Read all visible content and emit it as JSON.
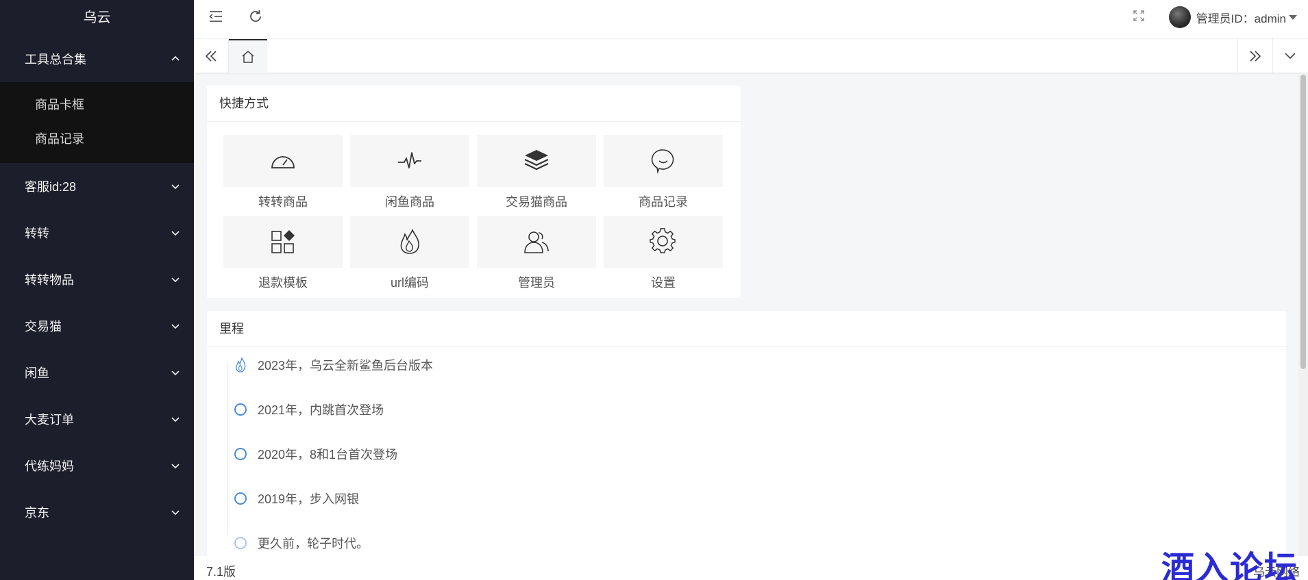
{
  "sidebar": {
    "logo": "乌云",
    "groups": [
      {
        "label": "工具总合集",
        "expanded": true,
        "items": [
          "商品卡框",
          "商品记录"
        ]
      },
      {
        "label": "客服id:28",
        "expanded": false
      },
      {
        "label": "转转",
        "expanded": false
      },
      {
        "label": "转转物品",
        "expanded": false
      },
      {
        "label": "交易猫",
        "expanded": false
      },
      {
        "label": "闲鱼",
        "expanded": false
      },
      {
        "label": "大麦订单",
        "expanded": false
      },
      {
        "label": "代练妈妈",
        "expanded": false
      },
      {
        "label": "京东",
        "expanded": false
      }
    ]
  },
  "header": {
    "user_label": "管理员ID：admin"
  },
  "shortcuts": {
    "title": "快捷方式",
    "items": [
      {
        "label": "转转商品",
        "icon": "dashboard-icon"
      },
      {
        "label": "闲鱼商品",
        "icon": "pulse-icon"
      },
      {
        "label": "交易猫商品",
        "icon": "layers-icon"
      },
      {
        "label": "商品记录",
        "icon": "chat-bubble-icon"
      },
      {
        "label": "退款模板",
        "icon": "apps-icon"
      },
      {
        "label": "url编码",
        "icon": "fire-icon"
      },
      {
        "label": "管理员",
        "icon": "users-icon"
      },
      {
        "label": "设置",
        "icon": "gear-icon"
      }
    ]
  },
  "milestones": {
    "title": "里程",
    "items": [
      "2023年，乌云全新鲨鱼后台版本",
      "2021年，内跳首次登场",
      "2020年，8和1台首次登场",
      "2019年，步入网银",
      "更久前，轮子时代。"
    ]
  },
  "footer": {
    "version": "7.1版",
    "right_text": "乌云网络"
  },
  "watermark": "酒入论坛",
  "colors": {
    "sidebar_bg": "#1d1e2c",
    "submenu_bg": "#121212",
    "timeline_accent": "#4a8ae0",
    "watermark": "#2b2bd6"
  }
}
